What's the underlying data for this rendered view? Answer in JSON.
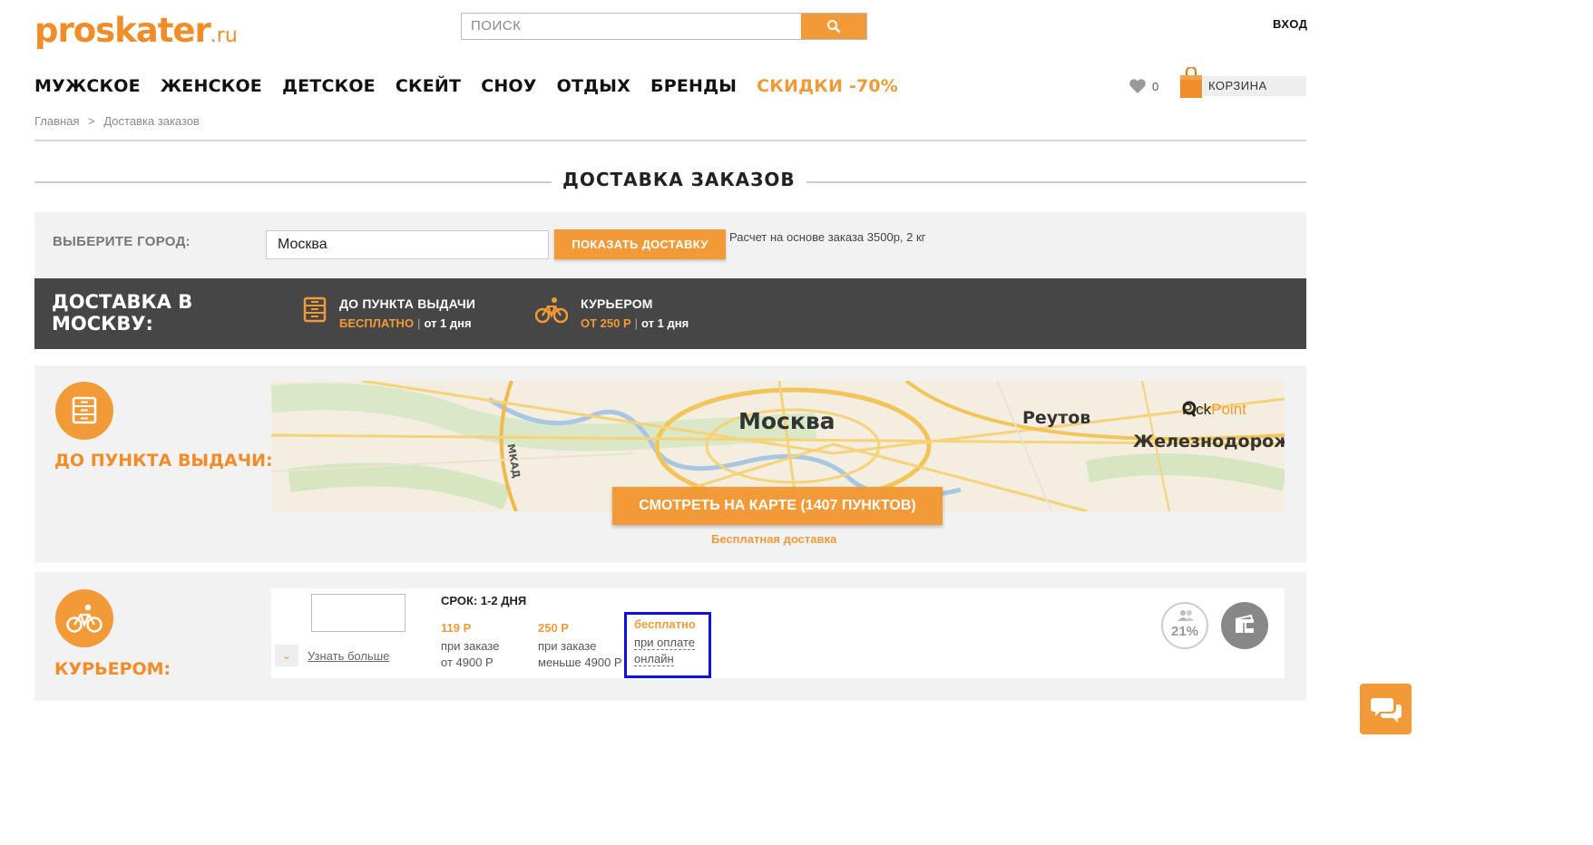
{
  "header": {
    "logo_main": "proskater",
    "logo_suffix": ".ru",
    "search_placeholder": "ПОИСК",
    "login": "ВХОД",
    "favorites_count": "0",
    "cart_label": "КОРЗИНА"
  },
  "nav": {
    "items": [
      "МУЖСКОЕ",
      "ЖЕНСКОЕ",
      "ДЕТСКОЕ",
      "СКЕЙТ",
      "СНОУ",
      "ОТДЫХ",
      "БРЕНДЫ"
    ],
    "sale": "СКИДКИ -70%"
  },
  "breadcrumb": {
    "home": "Главная",
    "separator": ">",
    "current": "Доставка заказов"
  },
  "page_title": "ДОСТАВКА ЗАКАЗОВ",
  "city_form": {
    "label": "ВЫБЕРИТЕ ГОРОД:",
    "value": "Москва",
    "button": "ПОКАЗАТЬ ДОСТАВКУ",
    "note": "Расчет на основе заказа 3500р, 2 кг"
  },
  "summary": {
    "heading": "ДОСТАВКА В МОСКВУ:",
    "pickup": {
      "title": "ДО ПУНКТА ВЫДАЧИ",
      "price": "БЕСПЛАТНО",
      "sep": "|",
      "term": "от 1 дня"
    },
    "courier": {
      "title": "КУРЬЕРОМ",
      "price": "ОТ 250 Р",
      "sep": "|",
      "term": "от 1 дня"
    }
  },
  "pickup_section": {
    "label": "ДО ПУНКТА ВЫДАЧИ:",
    "map_labels": {
      "moscow": "Москва",
      "reutov": "Реутов",
      "zheleznodor": "Железнодорож",
      "mkad": "МКАД",
      "pickpoint_a": "Pick",
      "pickpoint_b": "Point"
    },
    "map_button": "СМОТРЕТЬ НА КАРТЕ (1407 ПУНКТОВ)",
    "free_link": "Бесплатная доставка"
  },
  "courier_section": {
    "label": "КУРЬЕРОМ:",
    "more": "Узнать больше",
    "term": "СРОК: 1-2 ДНЯ",
    "tiers": [
      {
        "price": "119 Р",
        "line1": "при заказе",
        "line2": "от 4900 Р"
      },
      {
        "price": "250 Р",
        "line1": "при заказе",
        "line2": "меньше 4900 Р"
      },
      {
        "price": "бесплатно",
        "line1": "при оплате",
        "line2": "онлайн"
      }
    ],
    "discount_badge": "21%"
  },
  "colors": {
    "accent": "#f29a38",
    "dark_bar": "#464646",
    "panel": "#f2f2f2",
    "highlight_border": "#1010e0"
  }
}
